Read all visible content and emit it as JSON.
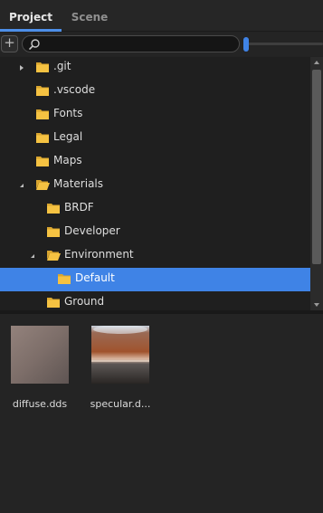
{
  "tabs": [
    {
      "label": "Project",
      "active": true
    },
    {
      "label": "Scene",
      "active": false
    }
  ],
  "toolbar": {
    "add_label": "+",
    "search_value": "",
    "search_placeholder": "",
    "thumbnail_size_fraction": 0.0
  },
  "tree": {
    "items": [
      {
        "label": ".git",
        "depth": 0,
        "expander": "collapsed",
        "selected": false
      },
      {
        "label": ".vscode",
        "depth": 0,
        "expander": "none",
        "selected": false
      },
      {
        "label": "Fonts",
        "depth": 0,
        "expander": "none",
        "selected": false
      },
      {
        "label": "Legal",
        "depth": 0,
        "expander": "none",
        "selected": false
      },
      {
        "label": "Maps",
        "depth": 0,
        "expander": "none",
        "selected": false
      },
      {
        "label": "Materials",
        "depth": 0,
        "expander": "expanded",
        "selected": false
      },
      {
        "label": "BRDF",
        "depth": 1,
        "expander": "none",
        "selected": false
      },
      {
        "label": "Developer",
        "depth": 1,
        "expander": "none",
        "selected": false
      },
      {
        "label": "Environment",
        "depth": 1,
        "expander": "expanded",
        "selected": false
      },
      {
        "label": "Default",
        "depth": 2,
        "expander": "none",
        "selected": true
      },
      {
        "label": "Ground",
        "depth": 1,
        "expander": "none",
        "selected": false
      }
    ]
  },
  "assets": [
    {
      "name": "diffuse.dds",
      "icon": "diffuse-texture-thumbnail"
    },
    {
      "name": "specular.d...",
      "icon": "specular-texture-thumbnail"
    }
  ],
  "colors": {
    "accent": "#3f83e6",
    "folder": "#f5c242",
    "background": "#1f1f1f"
  }
}
